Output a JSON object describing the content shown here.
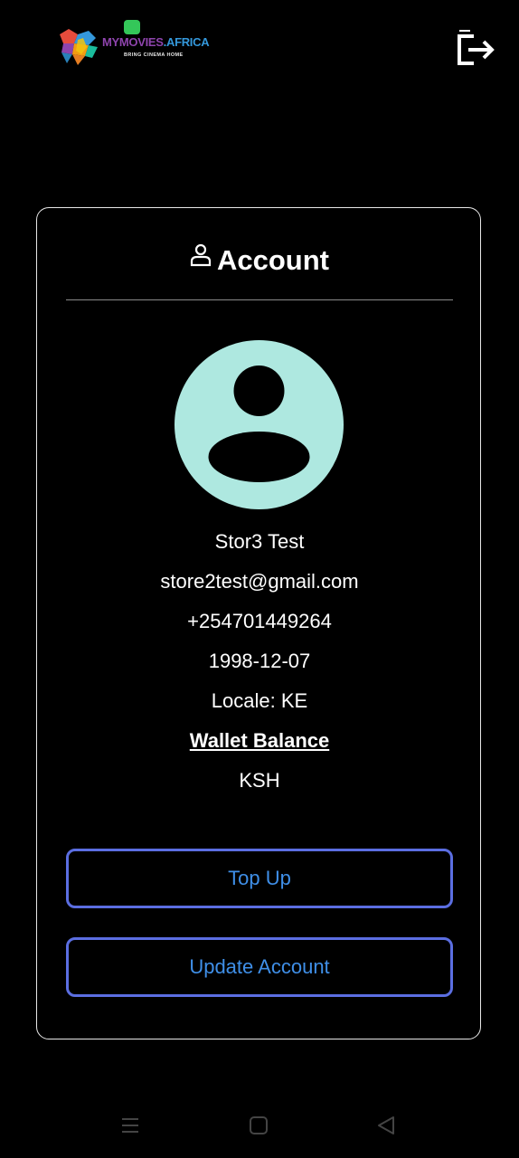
{
  "header": {
    "logo": {
      "text_part1": "MYMOVIES",
      "text_part2": ".AFRICA",
      "tagline": "BRING CINEMA HOME"
    },
    "logout_icon": "logout-icon"
  },
  "account": {
    "title": "Account",
    "title_icon": "user-icon",
    "avatar_icon": "avatar-icon",
    "name": "Stor3 Test",
    "email": "store2test@gmail.com",
    "phone": "+254701449264",
    "dob": "1998-12-07",
    "locale": "Locale: KE",
    "wallet_label": "Wallet Balance",
    "wallet_value": "KSH",
    "topup_label": "Top Up",
    "update_label": "Update Account"
  },
  "system_nav": {
    "menu_icon": "menu-icon",
    "home_icon": "home-square-icon",
    "back_icon": "back-triangle-icon"
  },
  "colors": {
    "background": "#000000",
    "avatar": "#aee8e0",
    "button_border": "#5b6ee1",
    "button_text": "#3f8fe8",
    "logo_green": "#34c759"
  }
}
